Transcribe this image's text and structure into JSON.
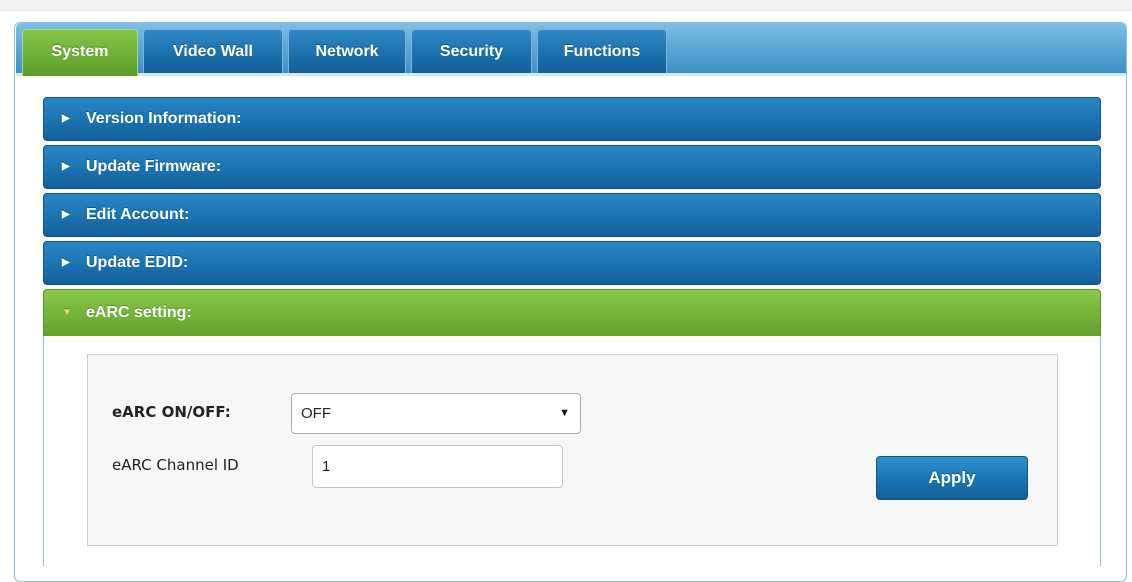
{
  "tabs": [
    {
      "label": "System",
      "active": true
    },
    {
      "label": "Video Wall",
      "active": false
    },
    {
      "label": "Network",
      "active": false
    },
    {
      "label": "Security",
      "active": false
    },
    {
      "label": "Functions",
      "active": false
    }
  ],
  "panels": [
    {
      "title": "Version Information:",
      "expanded": false
    },
    {
      "title": "Update Firmware:",
      "expanded": false
    },
    {
      "title": "Edit Account:",
      "expanded": false
    },
    {
      "title": "Update EDID:",
      "expanded": false
    },
    {
      "title": "eARC setting:",
      "expanded": true
    }
  ],
  "earc": {
    "onoff_label": "eARC ON/OFF:",
    "onoff_value": "OFF",
    "channel_label": "eARC Channel ID",
    "channel_value": "1",
    "apply_label": "Apply"
  },
  "icons": {
    "collapsed": "triangle-right-icon",
    "expanded": "triangle-down-icon",
    "dropdown": "caret-down-icon"
  },
  "colors": {
    "tab_active": "#6cae35",
    "tab_inactive": "#1a6faa",
    "panel_blue": "#1a72b2",
    "panel_green": "#73b33a"
  }
}
